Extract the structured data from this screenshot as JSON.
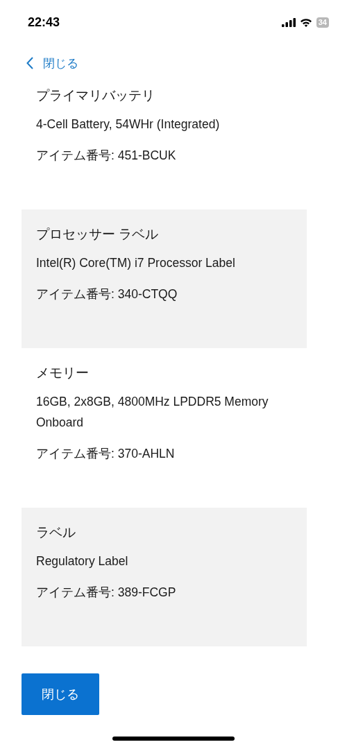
{
  "status_bar": {
    "time": "22:43",
    "battery": "34"
  },
  "back_link": {
    "label": "閉じる"
  },
  "items": [
    {
      "title": "プライマリバッテリ",
      "description": "4-Cell Battery, 54WHr (Integrated)",
      "part_number": "アイテム番号: 451-BCUK",
      "shaded": false
    },
    {
      "title": "プロセッサー ラベル",
      "description": "Intel(R) Core(TM) i7 Processor Label",
      "part_number": "アイテム番号: 340-CTQQ",
      "shaded": true
    },
    {
      "title": "メモリー",
      "description": "16GB, 2x8GB, 4800MHz LPDDR5 Memory Onboard",
      "part_number": "アイテム番号: 370-AHLN",
      "shaded": false
    },
    {
      "title": "ラベル",
      "description": "Regulatory Label",
      "part_number": "アイテム番号: 389-FCGP",
      "shaded": true
    }
  ],
  "close_button": {
    "label": "閉じる"
  }
}
